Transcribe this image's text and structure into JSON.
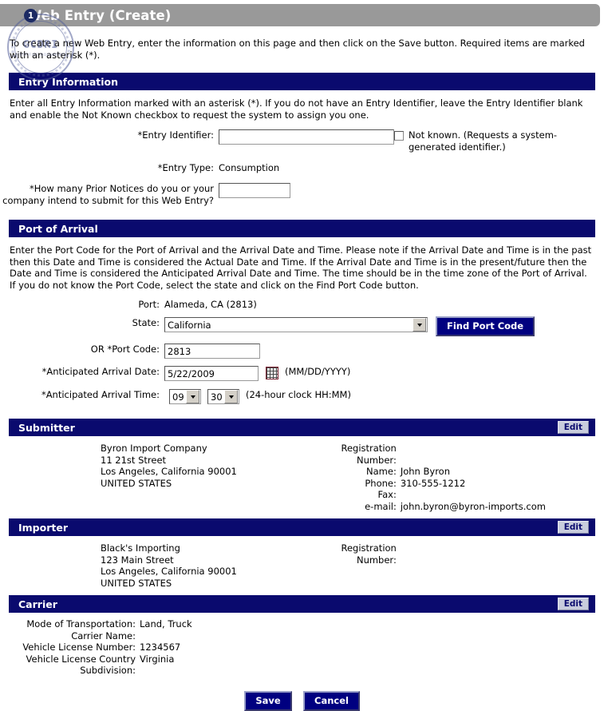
{
  "titlebar": {
    "step_number": "1",
    "title": "Web Entry (Create)",
    "seal_text": "GCDRI",
    "seal_subtext": "CERTIFIED DOCUMENT"
  },
  "intro": "To create a new Web Entry, enter the information on this page and then click on the Save button. Required items are marked with an asterisk (*).",
  "entry_information": {
    "heading": "Entry Information",
    "description": "Enter all Entry Information marked with an asterisk (*). If you do not have an Entry Identifier, leave the Entry Identifier blank and enable the Not Known checkbox to request the system to assign you one.",
    "entry_identifier_label": "*Entry Identifier:",
    "entry_identifier_value": "",
    "not_known_label": "Not known. (Requests a system-generated identifier.)",
    "not_known_checked": false,
    "entry_type_label": "*Entry Type:",
    "entry_type_value": "Consumption",
    "prior_notices_label": "*How many Prior Notices do you or your company intend to submit for this Web Entry?",
    "prior_notices_value": ""
  },
  "port_of_arrival": {
    "heading": "Port of Arrival",
    "description": "Enter the Port Code for the Port of Arrival and the Arrival Date and Time. Please note if the Arrival Date and Time is in the past then this Date and Time is considered the Actual Date and Time. If the Arrival Date and Time is in the present/future then the Date and Time is considered the Anticipated Arrival Date and Time. The time should be in the time zone of the Port of Arrival. If you do not know the Port Code, select the state and click on the Find Port Code button.",
    "port_label": "Port:",
    "port_value": "Alameda, CA (2813)",
    "state_label": "State:",
    "state_value": "California",
    "find_port_code_button": "Find Port Code",
    "port_code_label": "OR *Port Code:",
    "port_code_value": "2813",
    "arrival_date_label": "*Anticipated Arrival Date:",
    "arrival_date_value": "5/22/2009",
    "date_format_hint": "(MM/DD/YYYY)",
    "calendar_icon": "calendar-icon",
    "arrival_time_label": "*Anticipated Arrival Time:",
    "arrival_hour_value": "09",
    "arrival_minute_value": "30",
    "time_format_hint": "(24-hour clock HH:MM)"
  },
  "submitter": {
    "heading": "Submitter",
    "edit_label": "Edit",
    "address": "Byron Import Company\n11 21st Street\nLos Angeles, California  90001\nUNITED STATES",
    "fields": [
      {
        "key": "Registration\nNumber:",
        "value": ""
      },
      {
        "key": "Name:",
        "value": "John Byron"
      },
      {
        "key": "Phone:",
        "value": "310-555-1212"
      },
      {
        "key": "Fax:",
        "value": ""
      },
      {
        "key": "e-mail:",
        "value": "john.byron@byron-imports.com"
      }
    ]
  },
  "importer": {
    "heading": "Importer",
    "edit_label": "Edit",
    "address": "Black's Importing\n123 Main Street\nLos Angeles, California  90001\nUNITED STATES",
    "fields": [
      {
        "key": "Registration\nNumber:",
        "value": ""
      }
    ]
  },
  "carrier": {
    "heading": "Carrier",
    "edit_label": "Edit",
    "rows": [
      {
        "key": "Mode of Transportation:",
        "value": "Land, Truck"
      },
      {
        "key": "Carrier Name:",
        "value": ""
      },
      {
        "key": "Vehicle License Number:",
        "value": "1234567"
      },
      {
        "key": "Vehicle License Country Subdivision:",
        "value": "Virginia"
      }
    ]
  },
  "footer": {
    "save_label": "Save",
    "cancel_label": "Cancel"
  },
  "colors": {
    "section_bar": "#0a0a6e",
    "titlebar": "#999999",
    "button": "#000080",
    "edit_button": "#c8ccdd"
  }
}
